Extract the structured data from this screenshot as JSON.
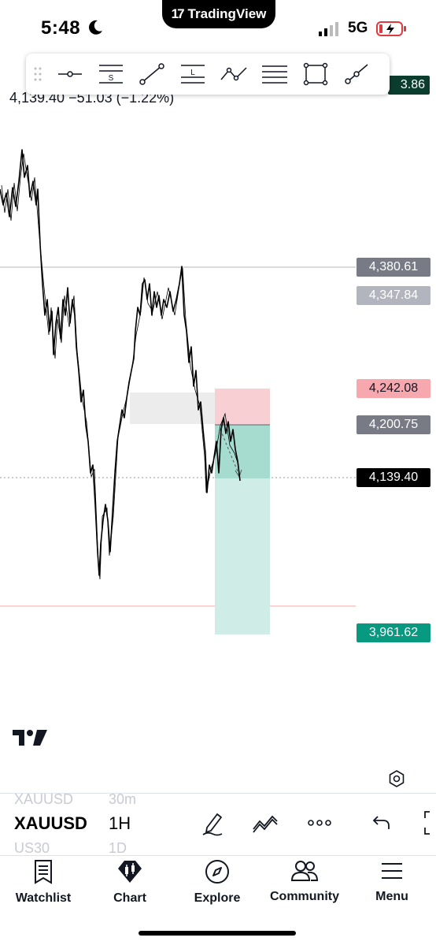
{
  "status_bar": {
    "time": "5:48",
    "network": "5G",
    "island_label": "TradingView"
  },
  "chart": {
    "readout": "4,139.40  −51.03 (−1.22%)",
    "top_tag": "3.86",
    "price_tags": {
      "resistance": "4,380.61",
      "high": "4,347.84",
      "stop_loss": "4,242.08",
      "entry": "4,200.75",
      "last": "4,139.40",
      "target": "3,961.62"
    }
  },
  "tabs_area": {
    "symbol": "XAUUSD",
    "timeframe": "1H",
    "ghost_symbol_above": "XAUUSD",
    "ghost_tf_above": "30m",
    "ghost_symbol_below": "US30",
    "ghost_tf_below": "1D"
  },
  "nav": {
    "watchlist": "Watchlist",
    "chart": "Chart",
    "explore": "Explore",
    "community": "Community",
    "menu": "Menu"
  },
  "colors": {
    "short_red": "#f8cfd3",
    "short_green": "#cfece6",
    "entry_green": "#a6dcd0",
    "target_tag": "#089981",
    "stop_tag": "#f7a8ae",
    "gray_tag": "#787b86"
  }
}
